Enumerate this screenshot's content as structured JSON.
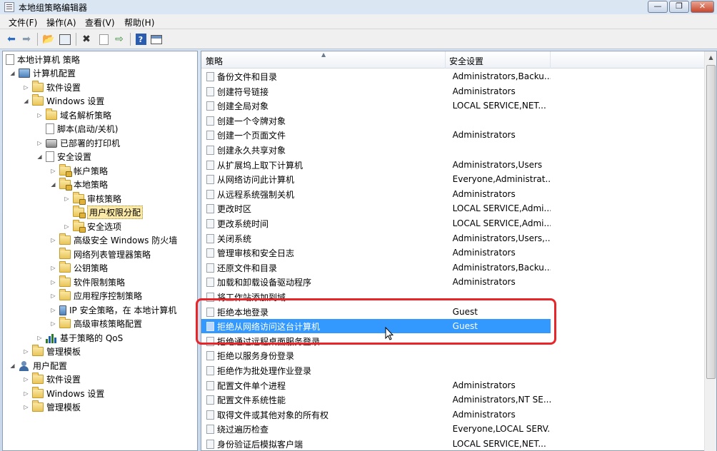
{
  "window": {
    "title": "本地组策略编辑器",
    "min_label": "—",
    "max_label": "❐",
    "close_label": "✕"
  },
  "menu": [
    "文件(F)",
    "操作(A)",
    "查看(V)",
    "帮助(H)"
  ],
  "toolbar_icons": [
    "back-arrow-icon",
    "forward-arrow-icon",
    "up-folder-icon",
    "show-tree-icon",
    "delete-icon",
    "properties-icon",
    "export-icon",
    "help-icon",
    "console-icon"
  ],
  "tree": [
    {
      "label": "本地计算机 策略",
      "icon": "policy"
    },
    {
      "label": "计算机配置",
      "icon": "computer"
    },
    {
      "label": "软件设置",
      "icon": "folder"
    },
    {
      "label": "Windows 设置",
      "icon": "folder"
    },
    {
      "label": "域名解析策略",
      "icon": "folder"
    },
    {
      "label": "脚本(启动/关机)",
      "icon": "doc"
    },
    {
      "label": "已部署的打印机",
      "icon": "printer"
    },
    {
      "label": "安全设置",
      "icon": "doc"
    },
    {
      "label": "帐户策略",
      "icon": "lock"
    },
    {
      "label": "本地策略",
      "icon": "lock"
    },
    {
      "label": "审核策略",
      "icon": "lock"
    },
    {
      "label": "用户权限分配",
      "icon": "lock"
    },
    {
      "label": "安全选项",
      "icon": "lock"
    },
    {
      "label": "高级安全 Windows 防火墙",
      "icon": "folder"
    },
    {
      "label": "网络列表管理器策略",
      "icon": "folder"
    },
    {
      "label": "公钥策略",
      "icon": "folder"
    },
    {
      "label": "软件限制策略",
      "icon": "folder"
    },
    {
      "label": "应用程序控制策略",
      "icon": "folder"
    },
    {
      "label": "IP 安全策略，在 本地计算机",
      "icon": "ipsec"
    },
    {
      "label": "高级审核策略配置",
      "icon": "folder"
    },
    {
      "label": "基于策略的 QoS",
      "icon": "chart"
    },
    {
      "label": "管理模板",
      "icon": "folder"
    },
    {
      "label": "用户配置",
      "icon": "user"
    },
    {
      "label": "软件设置",
      "icon": "folder"
    },
    {
      "label": "Windows 设置",
      "icon": "folder"
    },
    {
      "label": "管理模板",
      "icon": "folder"
    }
  ],
  "list": {
    "col_policy": "策略",
    "col_setting": "安全设置",
    "rows": [
      {
        "name": "备份文件和目录",
        "value": "Administrators,Backu..."
      },
      {
        "name": "创建符号链接",
        "value": "Administrators"
      },
      {
        "name": "创建全局对象",
        "value": "LOCAL SERVICE,NET..."
      },
      {
        "name": "创建一个令牌对象",
        "value": ""
      },
      {
        "name": "创建一个页面文件",
        "value": "Administrators"
      },
      {
        "name": "创建永久共享对象",
        "value": ""
      },
      {
        "name": "从扩展坞上取下计算机",
        "value": "Administrators,Users"
      },
      {
        "name": "从网络访问此计算机",
        "value": "Everyone,Administrat..."
      },
      {
        "name": "从远程系统强制关机",
        "value": "Administrators"
      },
      {
        "name": "更改时区",
        "value": "LOCAL SERVICE,Admi..."
      },
      {
        "name": "更改系统时间",
        "value": "LOCAL SERVICE,Admi..."
      },
      {
        "name": "关闭系统",
        "value": "Administrators,Users,..."
      },
      {
        "name": "管理审核和安全日志",
        "value": "Administrators"
      },
      {
        "name": "还原文件和目录",
        "value": "Administrators,Backu..."
      },
      {
        "name": "加载和卸载设备驱动程序",
        "value": "Administrators"
      },
      {
        "name": "将工作站添加到域",
        "value": ""
      },
      {
        "name": "拒绝本地登录",
        "value": "Guest"
      },
      {
        "name": "拒绝从网络访问这台计算机",
        "value": "Guest"
      },
      {
        "name": "拒绝通过远程桌面服务登录",
        "value": ""
      },
      {
        "name": "拒绝以服务身份登录",
        "value": ""
      },
      {
        "name": "拒绝作为批处理作业登录",
        "value": ""
      },
      {
        "name": "配置文件单个进程",
        "value": "Administrators"
      },
      {
        "name": "配置文件系统性能",
        "value": "Administrators,NT SE..."
      },
      {
        "name": "取得文件或其他对象的所有权",
        "value": "Administrators"
      },
      {
        "name": "绕过遍历检查",
        "value": "Everyone,LOCAL SERV..."
      },
      {
        "name": "身份验证后模拟客户端",
        "value": "LOCAL SERVICE,NET..."
      }
    ]
  }
}
